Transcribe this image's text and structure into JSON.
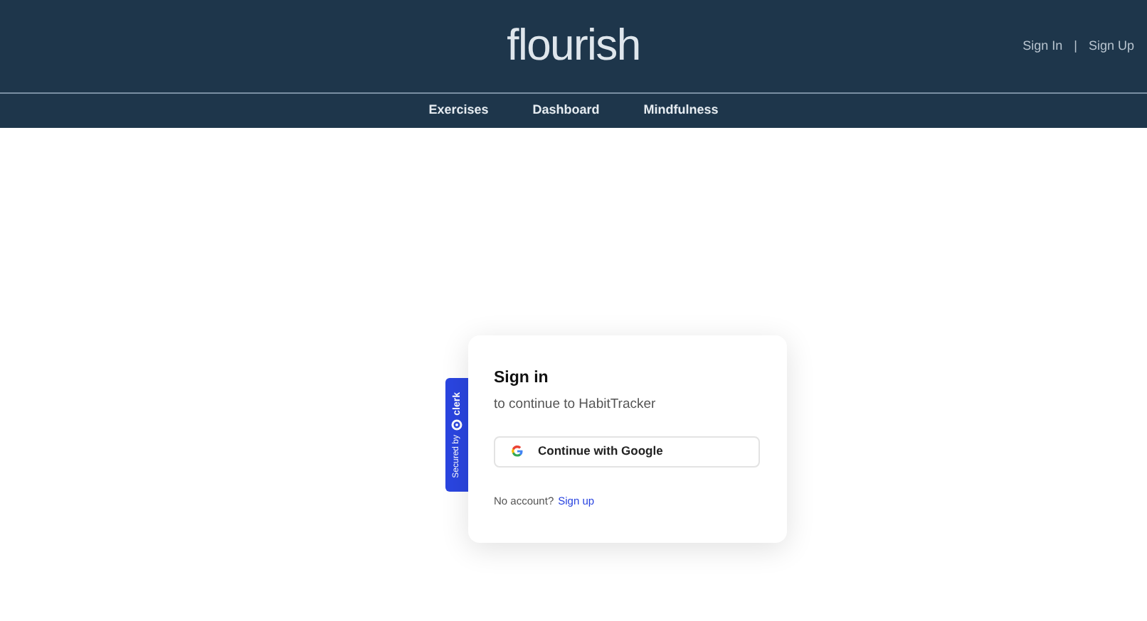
{
  "header": {
    "logo": "flourish",
    "auth_links": [
      "Sign In",
      "Sign Up"
    ],
    "separator": "|"
  },
  "nav": {
    "items": [
      {
        "label": "Exercises"
      },
      {
        "label": "Dashboard"
      },
      {
        "label": "Mindfulness"
      }
    ]
  },
  "sign_in_card": {
    "badge": {
      "secured_by": "Secured by",
      "brand": "clerk"
    },
    "title": "Sign in",
    "subtitle": "to continue to HabitTracker",
    "google_button": "Continue with Google",
    "footer_text": "No account?",
    "footer_link": "Sign up"
  }
}
